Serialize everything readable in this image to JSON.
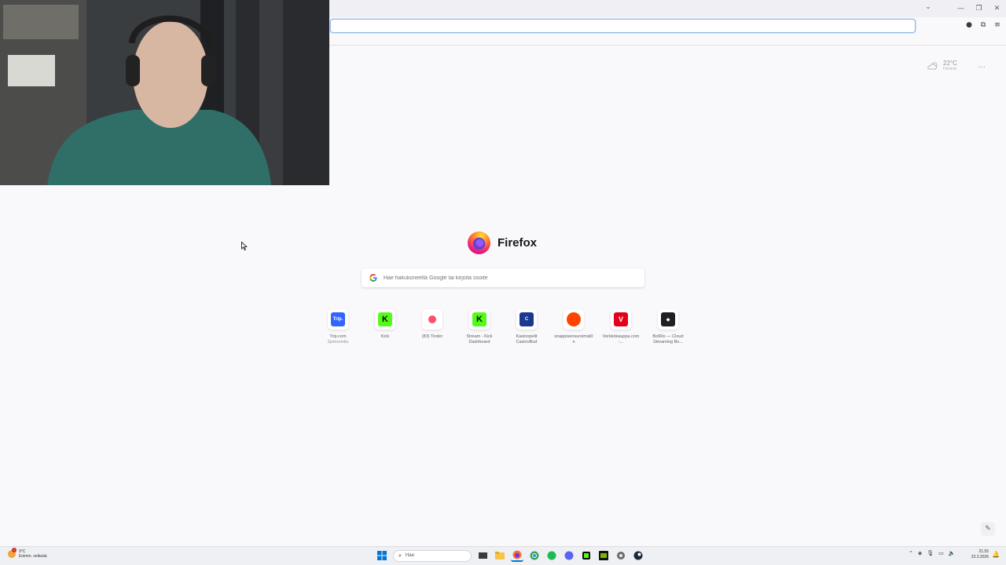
{
  "browser": {
    "url_value": "",
    "colors": {
      "accent": "#0060df",
      "background": "#f9f9fb",
      "urlbar_focus": "#8fb6e8"
    }
  },
  "weather": {
    "temperature": "22°C",
    "location": "Helsinki",
    "icon": "partly-cloudy-icon"
  },
  "logo": {
    "text": "Firefox"
  },
  "search": {
    "placeholder": "Hae hakukoneella Google tai kirjoita osoite"
  },
  "top_sites": [
    {
      "label": "Trip.com",
      "sub": "Sponsoroitu",
      "icon_text": "Trip.",
      "color": "#3264ff"
    },
    {
      "label": "Kick",
      "sub": "",
      "icon_text": "K",
      "color": "#53fc18"
    },
    {
      "label": "(83) Tinder",
      "sub": "",
      "icon_text": "",
      "color": "#fd5068"
    },
    {
      "label": "Stream - Kick Dashboard",
      "sub": "",
      "icon_text": "K",
      "color": "#53fc18"
    },
    {
      "label": "Kasinopelit CasinoBud",
      "sub": "",
      "icon_text": "C",
      "color": "#1b3a8f"
    },
    {
      "label": "snappisensuroimat0n",
      "sub": "",
      "icon_text": "",
      "color": "#ff4500"
    },
    {
      "label": "Verkkokauppa.com -...",
      "sub": "",
      "icon_text": "V",
      "color": "#e3001b"
    },
    {
      "label": "BotRix — Cloud Streaming Bo...",
      "sub": "",
      "icon_text": "◆",
      "color": "#1f2024"
    }
  ],
  "taskbar": {
    "weather_temp": "9°C",
    "weather_desc": "Enimm. selkeää",
    "weather_badge": "1",
    "search_text": "Hae",
    "time": "21.55",
    "date": "23.3.2026"
  }
}
